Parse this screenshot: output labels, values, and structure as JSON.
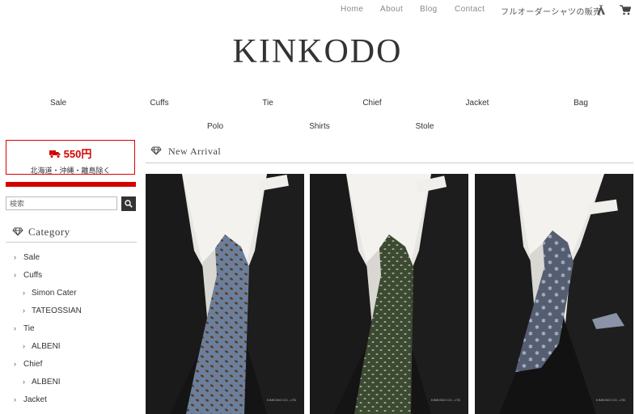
{
  "top_nav": {
    "home": "Home",
    "about": "About",
    "blog": "Blog",
    "contact": "Contact",
    "order_shirts": "フルオーダーシャツの販売",
    "tent_icon": "teepee-icon",
    "cart_icon": "cart-icon"
  },
  "logo": "KINKODO",
  "category_nav": {
    "row1": [
      "Sale",
      "Cuffs",
      "Tie",
      "Chief",
      "Jacket",
      "Bag"
    ],
    "row2": [
      "Polo",
      "Shirts",
      "Stole"
    ]
  },
  "shipping": {
    "price": "550円",
    "note": "北海道・沖縄・離島除く",
    "icon": "truck-icon",
    "accent": "#d40000"
  },
  "search": {
    "placeholder": "検索",
    "icon": "search-icon"
  },
  "category_section": {
    "title": "Category",
    "icon": "diamond-icon",
    "items": [
      {
        "label": "Sale",
        "level": 0
      },
      {
        "label": "Cuffs",
        "level": 0
      },
      {
        "label": "Simon Cater",
        "level": 1
      },
      {
        "label": "TATEOSSIAN",
        "level": 1
      },
      {
        "label": "Tie",
        "level": 0
      },
      {
        "label": "ALBENI",
        "level": 1
      },
      {
        "label": "Chief",
        "level": 0
      },
      {
        "label": "ALBENI",
        "level": 1
      },
      {
        "label": "Jacket",
        "level": 0
      }
    ]
  },
  "new_arrival": {
    "title": "New Arrival",
    "icon": "diamond-icon",
    "products": [
      {
        "tie_color": "#6b7f9c",
        "pattern": "paisley",
        "watermark": "KINKODO CO., LTD"
      },
      {
        "tie_color": "#3c4a2f",
        "pattern": "dots",
        "watermark": "KINKODO CO., LTD"
      },
      {
        "tie_color": "#555d70",
        "pattern": "stars",
        "watermark": "KINKODO CO., LTD"
      }
    ]
  }
}
